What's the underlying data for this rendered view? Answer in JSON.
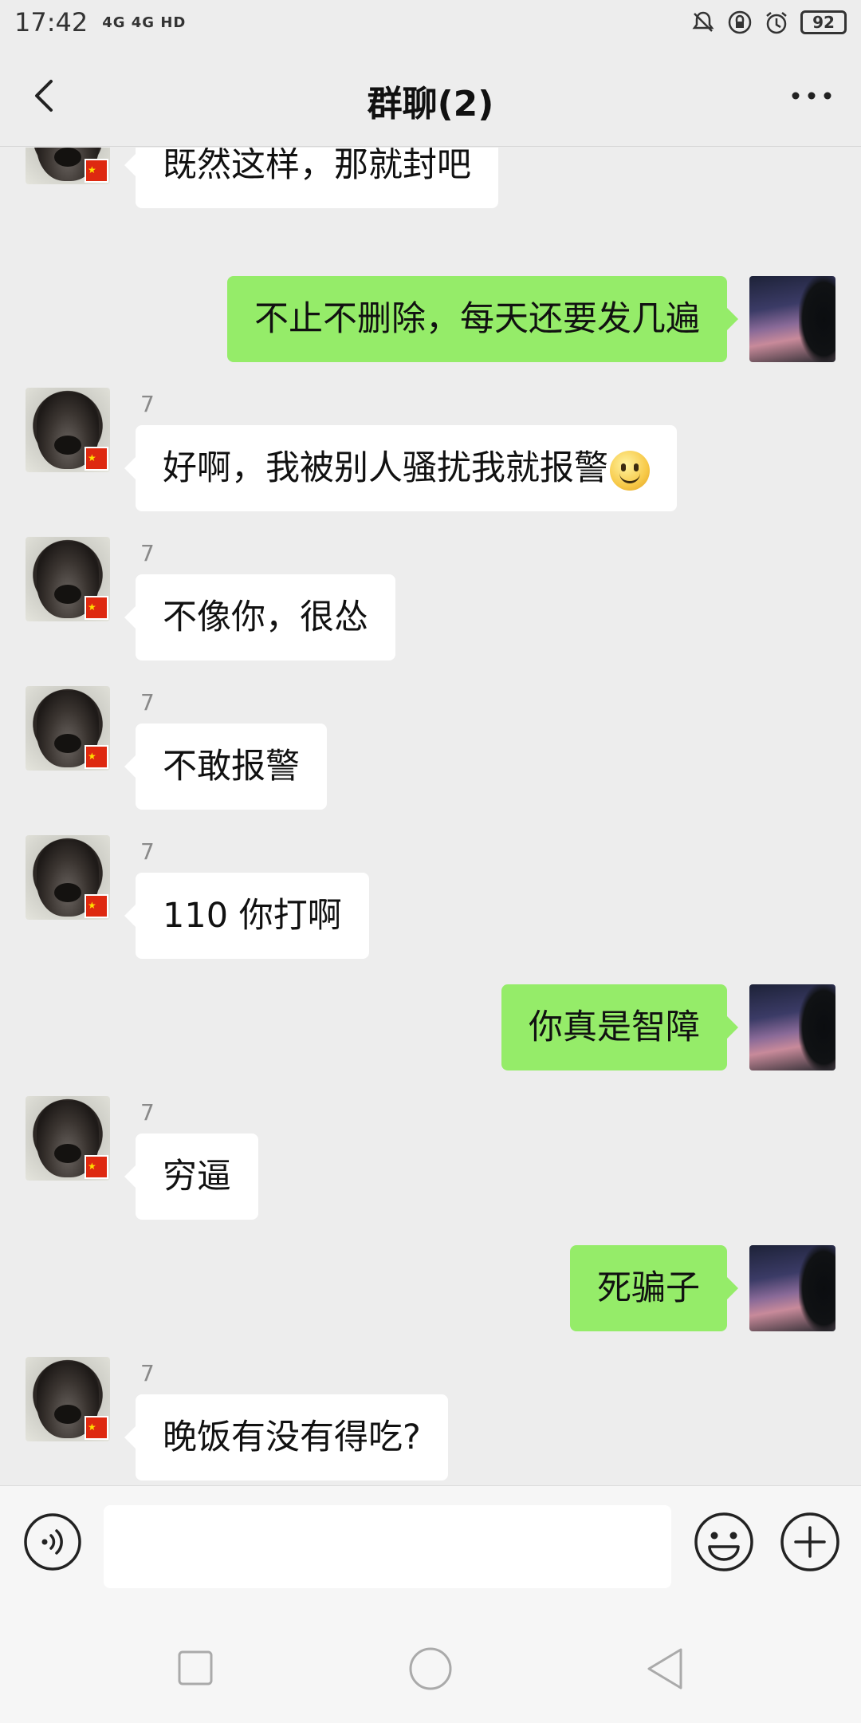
{
  "status_bar": {
    "time": "17:42",
    "signal_text": "4G 4G HD",
    "battery": "92"
  },
  "header": {
    "title": "群聊(2)"
  },
  "messages": [
    {
      "side": "left",
      "sender": "7",
      "text": "既然这样，那就封吧"
    },
    {
      "side": "right",
      "text": "不止不删除，每天还要发几遍"
    },
    {
      "side": "left",
      "sender": "7",
      "text": "好啊，我被别人骚扰我就报警"
    },
    {
      "side": "left",
      "sender": "7",
      "text": "不像你，很怂"
    },
    {
      "side": "left",
      "sender": "7",
      "text": "不敢报警"
    },
    {
      "side": "left",
      "sender": "7",
      "text": "110 你打啊"
    },
    {
      "side": "right",
      "text": "你真是智障"
    },
    {
      "side": "left",
      "sender": "7",
      "text": "穷逼"
    },
    {
      "side": "right",
      "text": "死骗子"
    },
    {
      "side": "left",
      "sender": "7",
      "text": "晚饭有没有得吃?"
    }
  ],
  "input": {
    "value": ""
  },
  "colors": {
    "background": "#ededed",
    "bubble_self": "#95ec69",
    "bubble_other": "#ffffff"
  },
  "icons": [
    "back-icon",
    "more-icon",
    "voice-icon",
    "emoji-icon",
    "plus-icon",
    "nav-recent-icon",
    "nav-home-icon",
    "nav-back-icon",
    "smile-emoji"
  ]
}
